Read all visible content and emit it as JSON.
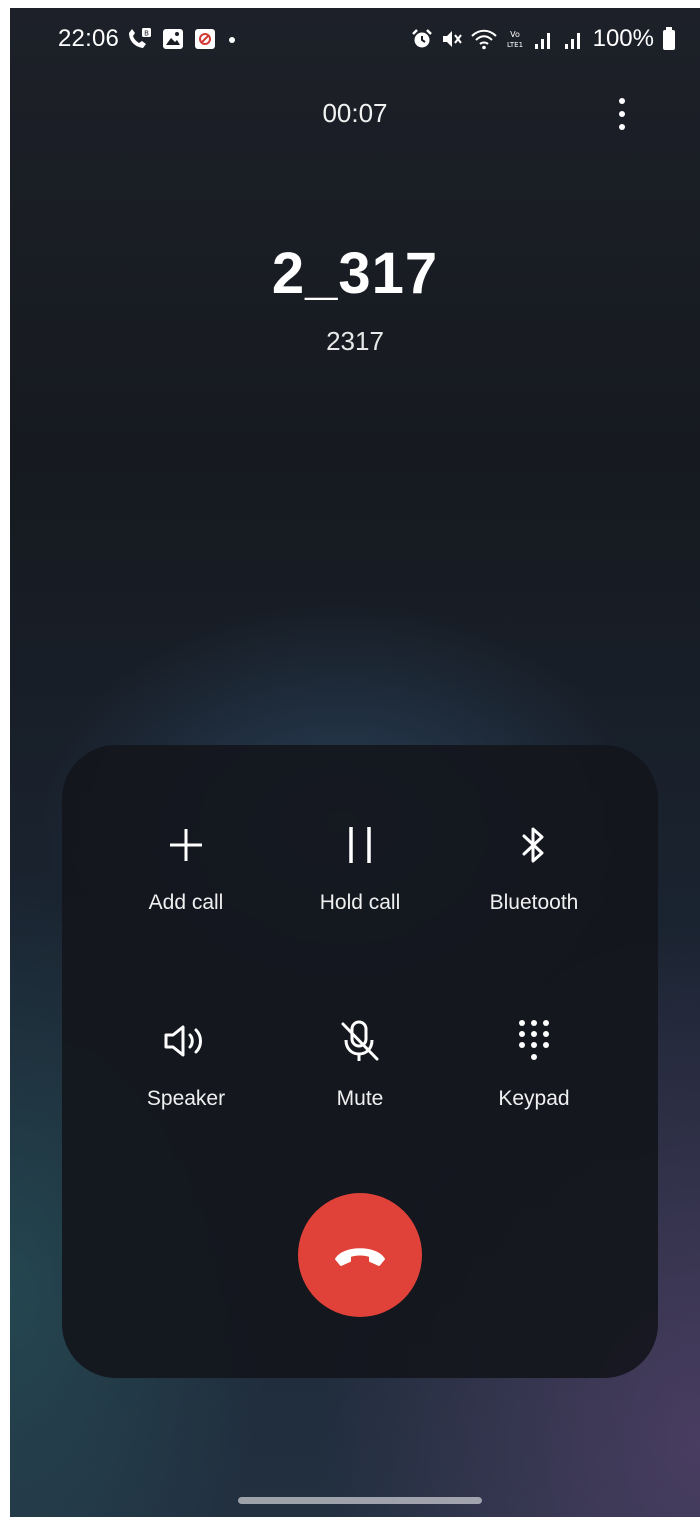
{
  "status_bar": {
    "time": "22:06",
    "left_icons": [
      "wifi-calling-icon",
      "gallery-icon",
      "blocked-notification-icon",
      "dot-icon"
    ],
    "right_icons": [
      "alarm-icon",
      "mute-icon",
      "wifi-icon",
      "volte-icon",
      "signal-icon",
      "signal-icon-2"
    ],
    "battery": "100%"
  },
  "call": {
    "timer": "00:07",
    "name": "2_317",
    "number": "2317"
  },
  "controls": {
    "add_call": "Add call",
    "hold_call": "Hold call",
    "bluetooth": "Bluetooth",
    "speaker": "Speaker",
    "mute": "Mute",
    "keypad": "Keypad"
  },
  "colors": {
    "end_call": "#e0423a",
    "panel": "#14161c"
  }
}
